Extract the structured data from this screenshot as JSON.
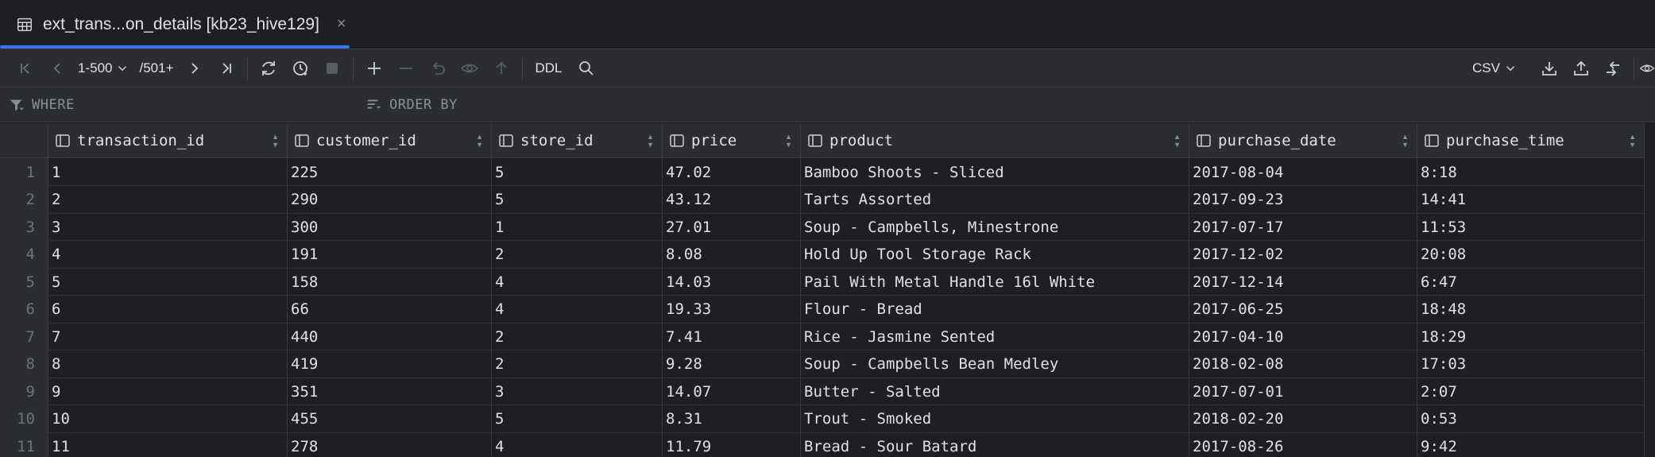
{
  "tab": {
    "title": "ext_trans...on_details [kb23_hive129]",
    "icon": "table-icon",
    "close": "×"
  },
  "toolbar": {
    "range": "1-500",
    "total": "/501+",
    "ddl": "DDL",
    "export_format": "CSV"
  },
  "filter": {
    "where": "WHERE",
    "order_by": "ORDER BY"
  },
  "columns": [
    "transaction_id",
    "customer_id",
    "store_id",
    "price",
    "product",
    "purchase_date",
    "purchase_time"
  ],
  "rows": [
    {
      "n": "1",
      "cells": [
        "1",
        "225",
        "5",
        "47.02",
        "Bamboo Shoots - Sliced",
        "2017-08-04",
        "8:18"
      ]
    },
    {
      "n": "2",
      "cells": [
        "2",
        "290",
        "5",
        "43.12",
        "Tarts Assorted",
        "2017-09-23",
        "14:41"
      ]
    },
    {
      "n": "3",
      "cells": [
        "3",
        "300",
        "1",
        "27.01",
        "Soup - Campbells, Minestrone",
        "2017-07-17",
        "11:53"
      ]
    },
    {
      "n": "4",
      "cells": [
        "4",
        "191",
        "2",
        "8.08",
        "Hold Up Tool Storage Rack",
        "2017-12-02",
        "20:08"
      ]
    },
    {
      "n": "5",
      "cells": [
        "5",
        "158",
        "4",
        "14.03",
        "Pail With Metal Handle 16l White",
        "2017-12-14",
        "6:47"
      ]
    },
    {
      "n": "6",
      "cells": [
        "6",
        "66",
        "4",
        "19.33",
        "Flour - Bread",
        "2017-06-25",
        "18:48"
      ]
    },
    {
      "n": "7",
      "cells": [
        "7",
        "440",
        "2",
        "7.41",
        "Rice - Jasmine Sented",
        "2017-04-10",
        "18:29"
      ]
    },
    {
      "n": "8",
      "cells": [
        "8",
        "419",
        "2",
        "9.28",
        "Soup - Campbells Bean Medley",
        "2018-02-08",
        "17:03"
      ]
    },
    {
      "n": "9",
      "cells": [
        "9",
        "351",
        "3",
        "14.07",
        "Butter - Salted",
        "2017-07-01",
        "2:07"
      ]
    },
    {
      "n": "10",
      "cells": [
        "10",
        "455",
        "5",
        "8.31",
        "Trout - Smoked",
        "2018-02-20",
        "0:53"
      ]
    },
    {
      "n": "11",
      "cells": [
        "11",
        "278",
        "4",
        "11.79",
        "Bread - Sour Batard",
        "2017-08-26",
        "9:42"
      ]
    }
  ],
  "colors": {
    "accent": "#3574f0",
    "background": "#1e1f22",
    "panel": "#2b2d30"
  }
}
